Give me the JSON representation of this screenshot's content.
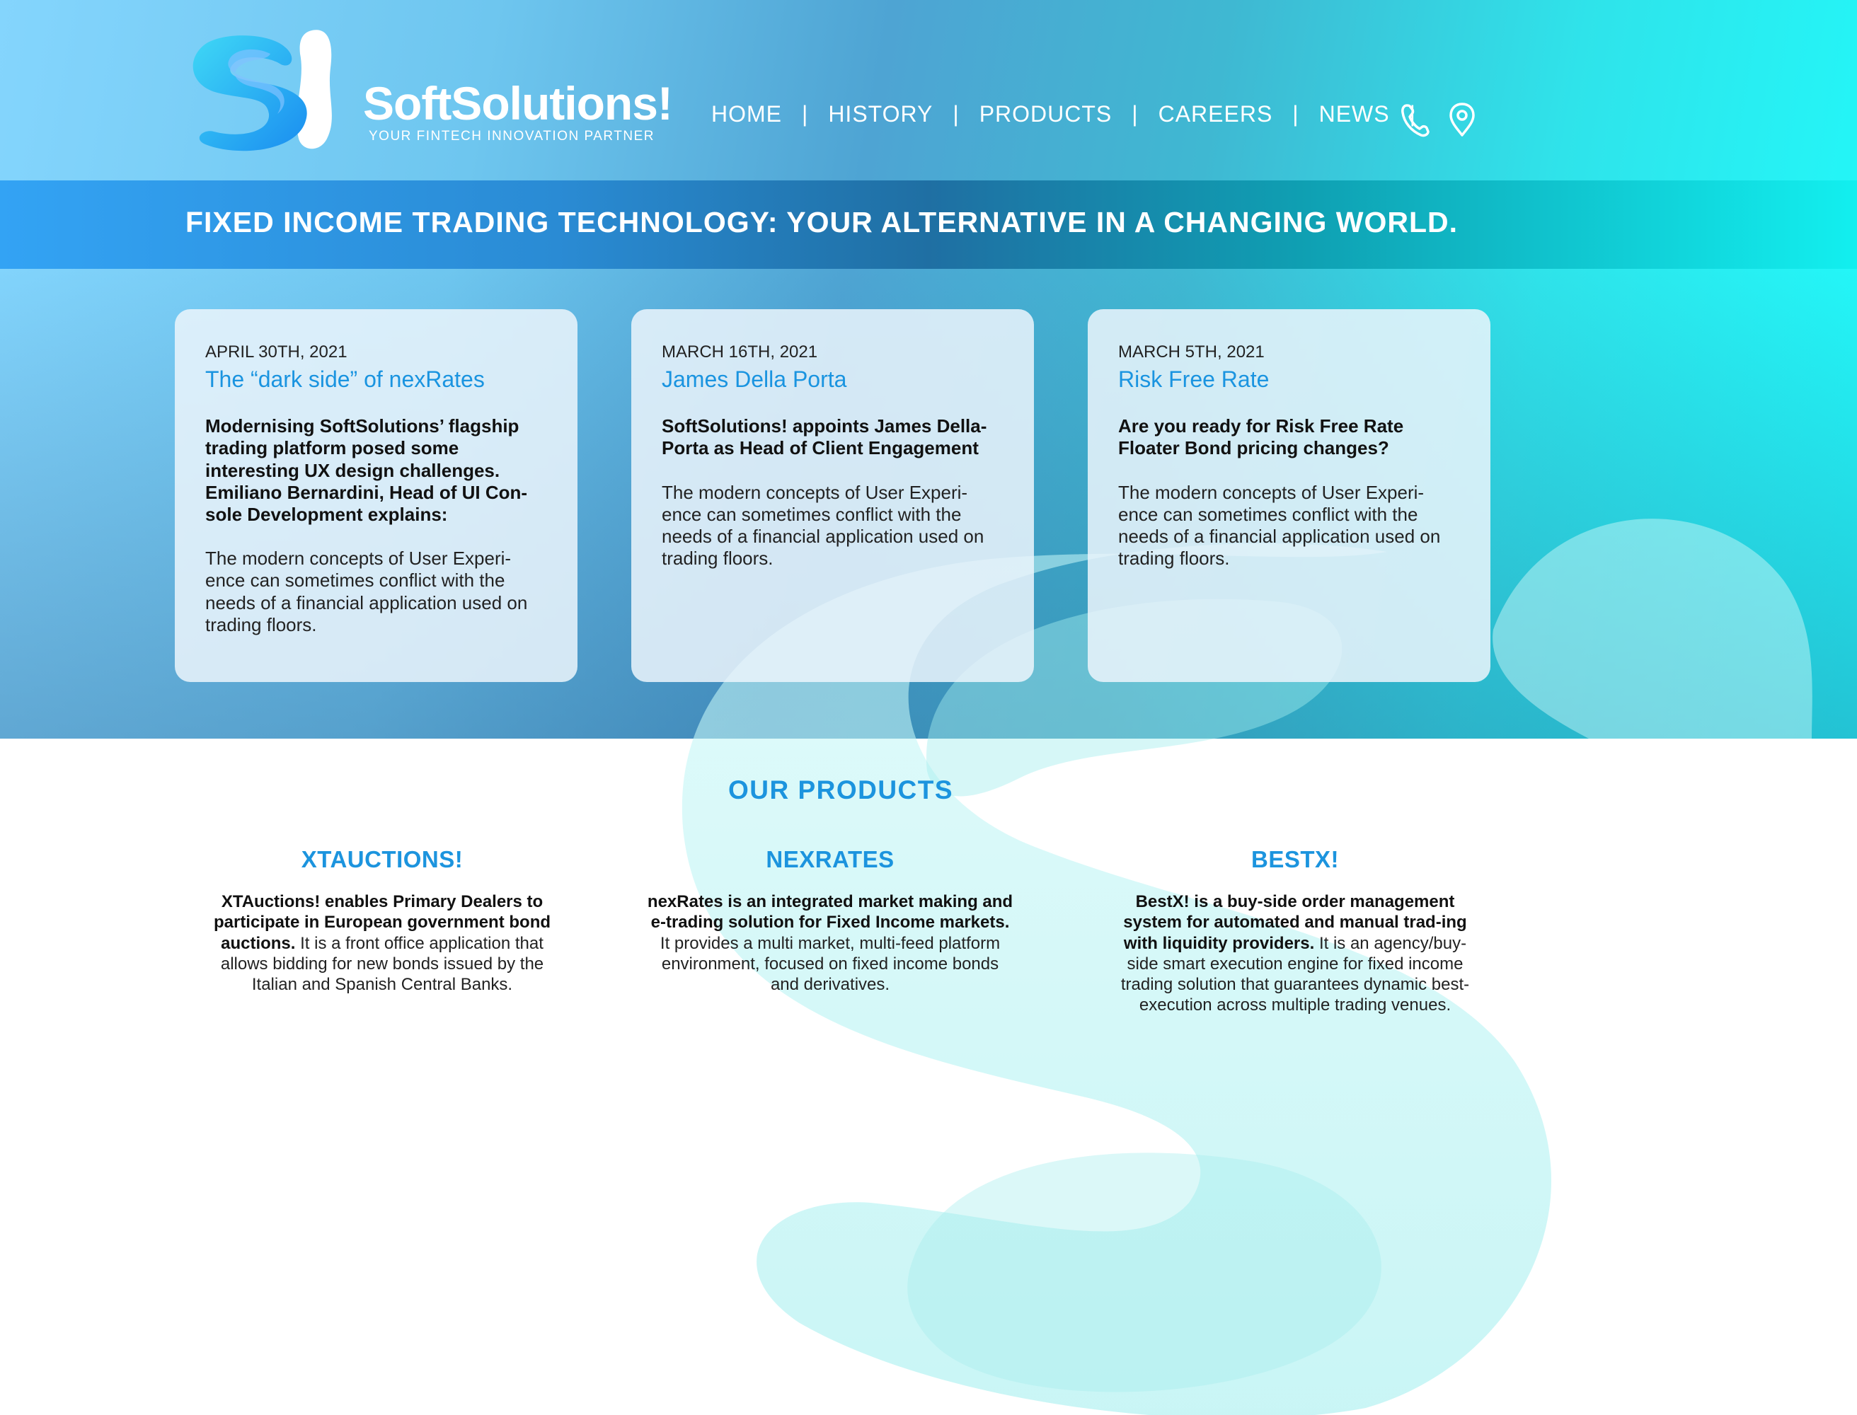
{
  "brand": {
    "name": "SoftSolutions!",
    "tagline": "YOUR FINTECH INNOVATION PARTNER",
    "colors": {
      "accent": "#1c94de",
      "banner_start": "#33a3f4",
      "hero_end": "#20fbfb",
      "blob": "#b4f3f3"
    }
  },
  "nav": {
    "items": [
      "HOME",
      "HISTORY",
      "PRODUCTS",
      "CAREERS",
      "NEWS"
    ],
    "separator": "|",
    "icons": [
      "phone-icon",
      "location-pin-icon"
    ]
  },
  "banner": {
    "title": "FIXED INCOME TRADING TECHNOLOGY: YOUR ALTERNATIVE IN A CHANGING WORLD."
  },
  "news": [
    {
      "date": "APRIL 30TH, 2021",
      "title": "The “dark side” of nexRates",
      "lead": "Modernising SoftSolutions’ flagship trading platform posed some interesting UX design challenges. Emiliano Bernardini, Head of UI Con-sole Development explains:",
      "body": "The modern concepts of User Experi-ence can sometimes conflict with the needs of a financial application used on trading floors."
    },
    {
      "date": "MARCH 16TH, 2021",
      "title": "James Della Porta",
      "lead": "SoftSolutions! appoints James Della-Porta as Head of Client Engagement",
      "body": "The modern concepts of User Experi-ence can sometimes conflict with the needs of a financial application used on trading floors."
    },
    {
      "date": "MARCH 5TH, 2021",
      "title": "Risk Free Rate",
      "lead": "Are you ready for Risk Free Rate Floater Bond pricing changes?",
      "body": "The modern concepts of User Experi-ence can sometimes conflict with the needs of a financial application used on trading floors."
    }
  ],
  "products": {
    "title": "OUR PRODUCTS",
    "items": [
      {
        "name": "XTAUCTIONS!",
        "bold": "XTAuctions! enables Primary Dealers to participate in European government bond auctions.",
        "text": " It is a front office application that allows bidding for new bonds issued by the Italian and Spanish Central Banks."
      },
      {
        "name": "NEXRATES",
        "bold": "nexRates is an integrated market making and e-trading solution for Fixed Income markets.",
        "text": " It provides a multi market, multi-feed platform environment, focused on fixed income bonds and derivatives."
      },
      {
        "name": "BESTX!",
        "bold": "BestX! is a buy-side order management system for automated and manual trad-ing with liquidity providers.",
        "text": " It is an agency/buy-side smart execution engine for fixed income trading solution that guarantees dynamic best-execution across multiple trading venues."
      }
    ]
  }
}
